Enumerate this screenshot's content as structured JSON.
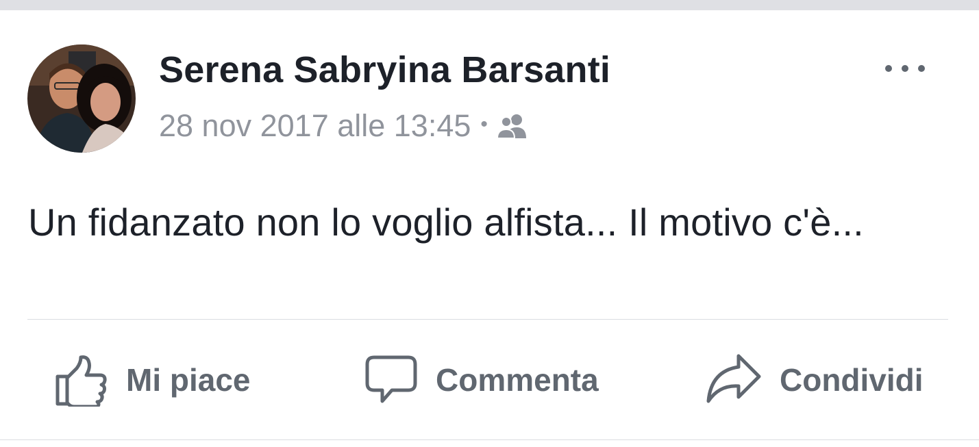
{
  "post": {
    "author": "Serena Sabryina Barsanti",
    "timestamp": "28 nov 2017 alle 13:45",
    "separator": "•",
    "audience_icon": "friends-icon",
    "more_icon": "more-options-icon",
    "text": "Un fidanzato non lo voglio alfista... Il motivo c'è..."
  },
  "actions": {
    "like": {
      "label": "Mi piace",
      "icon": "thumbs-up-icon"
    },
    "comment": {
      "label": "Commenta",
      "icon": "comment-bubble-icon"
    },
    "share": {
      "label": "Condividi",
      "icon": "share-arrow-icon"
    }
  },
  "colors": {
    "author_text": "#1d2129",
    "meta_text": "#90949c",
    "action_text": "#606770",
    "divider": "#dadde1",
    "top_strip": "#dfe0e4"
  }
}
